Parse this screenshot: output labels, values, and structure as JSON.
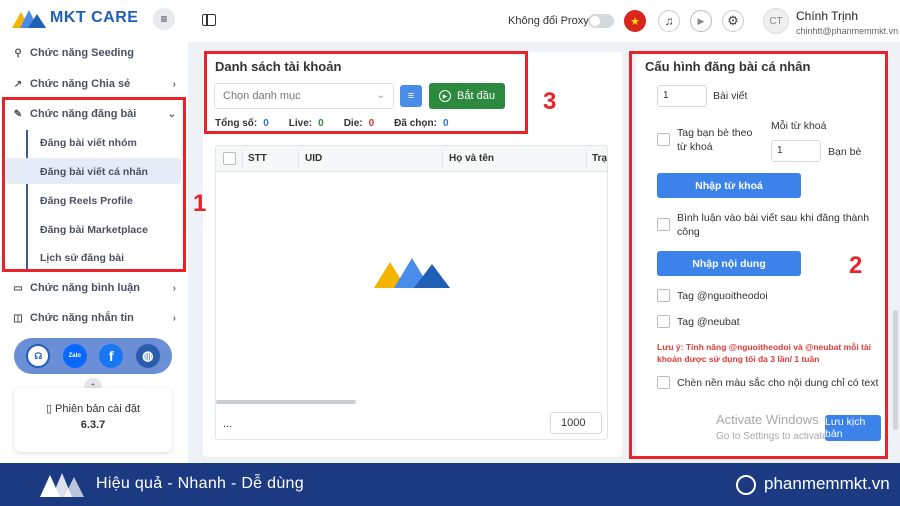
{
  "app": {
    "logo_text": "MKT CARE"
  },
  "sidebar": {
    "items": [
      {
        "label": "Chức năng Seeding"
      },
      {
        "label": "Chức năng Chia sẻ"
      },
      {
        "label": "Chức năng đăng bài"
      },
      {
        "label": "Chức năng bình luận"
      },
      {
        "label": "Chức năng nhắn tin"
      }
    ],
    "sub_items": [
      {
        "label": "Đăng bài viết nhóm"
      },
      {
        "label": "Đăng bài viết cá nhân"
      },
      {
        "label": "Đăng Reels Profile"
      },
      {
        "label": "Đăng bài Marketplace"
      },
      {
        "label": "Lịch sử đăng bài"
      }
    ],
    "social": {
      "zalo": "Zalo",
      "facebook": "f"
    },
    "version": {
      "label": "Phiên bản cài đặt",
      "number": "6.3.7"
    }
  },
  "header": {
    "proxy_label": "Không đổi Proxy",
    "user_initials": "CT",
    "user_name": "Chính Trịnh",
    "user_email": "chinhtt@phanmemmkt.vn"
  },
  "accounts": {
    "title": "Danh sách tài khoản",
    "category_placeholder": "Chọn danh mục",
    "start_label": "Bắt đầu",
    "stats": {
      "total_label": "Tổng số:",
      "total": "0",
      "live_label": "Live:",
      "live": "0",
      "die_label": "Die:",
      "die": "0",
      "selected_label": "Đã chọn:",
      "selected": "0"
    },
    "columns": [
      "STT",
      "UID",
      "Họ và tên",
      "Trạ"
    ],
    "footer_dots": "...",
    "page_size": "1000"
  },
  "config": {
    "title": "Cấu hình đăng bài cá nhân",
    "posts_value": "1",
    "posts_label": "Bài viết",
    "tag_friends_label": "Tag bạn bè theo từ khoá",
    "per_keyword_label": "Mỗi từ khoá",
    "friends_value": "1",
    "friends_label": "Bạn bè",
    "import_keywords": "Nhập từ khoá",
    "comment_after_label": "Bình luận vào bài viết sau khi đăng thành công",
    "import_content": "Nhập nội dung",
    "tag_follow_label": "Tag @nguoitheodoi",
    "tag_neubat_label": "Tag @neubat",
    "note": "Lưu ý: Tính năng @nguoitheodoi và @neubat mỗi tài khoản được sử dụng tối đa 3 lần/ 1 tuần",
    "bg_color_label": "Chèn nền màu sắc cho nội dung chỉ có text",
    "save_label": "Lưu kịch bản",
    "activate_title": "Activate Windows",
    "activate_sub": "Go to Settings to activate Windows."
  },
  "annotations": {
    "one": "1",
    "two": "2",
    "three": "3"
  },
  "footer": {
    "slogan": "Hiệu quả - Nhanh - Dễ dùng",
    "site": "phanmemmkt.vn"
  },
  "colors": {
    "brand_blue": "#1f5fb5",
    "annotation_red": "#e8232a",
    "start_green": "#2b8a3e",
    "button_blue": "#3b82ea",
    "footer_navy": "#1b3a82"
  }
}
